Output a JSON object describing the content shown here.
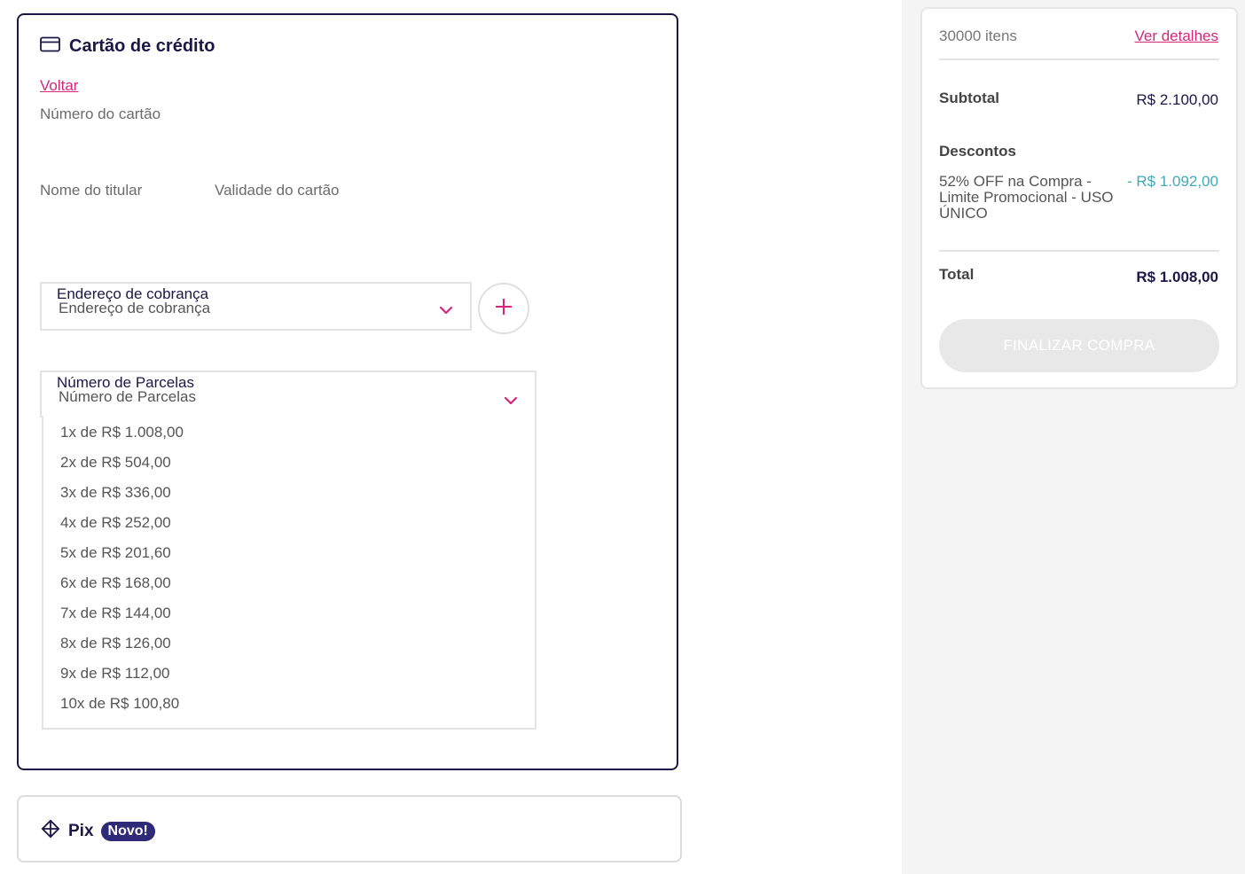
{
  "credit_card": {
    "title": "Cartão de crédito",
    "back_link": "Voltar",
    "card_number_label": "Número do cartão",
    "holder_name_label": "Nome do titular",
    "expiry_label": "Validade do cartão",
    "billing_address": {
      "label": "Endereço de cobrança",
      "value": "Endereço de cobrança"
    },
    "installments": {
      "label": "Número de Parcelas",
      "value": "Número de Parcelas",
      "options": [
        "1x de R$ 1.008,00",
        "2x de R$ 504,00",
        "3x de R$ 336,00",
        "4x de R$ 252,00",
        "5x de R$ 201,60",
        "6x de R$ 168,00",
        "7x de R$ 144,00",
        "8x de R$ 126,00",
        "9x de R$ 112,00",
        "10x de R$ 100,80"
      ]
    }
  },
  "pix": {
    "title": "Pix",
    "badge": "Novo!"
  },
  "summary": {
    "items_count": "30000 itens",
    "details_link": "Ver detalhes",
    "subtotal_label": "Subtotal",
    "subtotal_value": "R$ 2.100,00",
    "discounts_label": "Descontos",
    "discount_description": "52% OFF na Compra - Limite Promocional - USO ÚNICO",
    "discount_value": "- R$ 1.092,00",
    "total_label": "Total",
    "total_value": "R$ 1.008,00",
    "finalize_button": "FINALIZAR COMPRA"
  },
  "colors": {
    "brand_navy": "#1b1746",
    "link_pink": "#d6257a",
    "discount_teal": "#3fa9b5",
    "badge_purple": "#2e2a78",
    "disabled_button": "#e8e8e8"
  },
  "icons": {
    "card": "credit-card-icon",
    "chevron": "chevron-down-icon",
    "add": "plus-icon",
    "pix": "pix-icon"
  }
}
